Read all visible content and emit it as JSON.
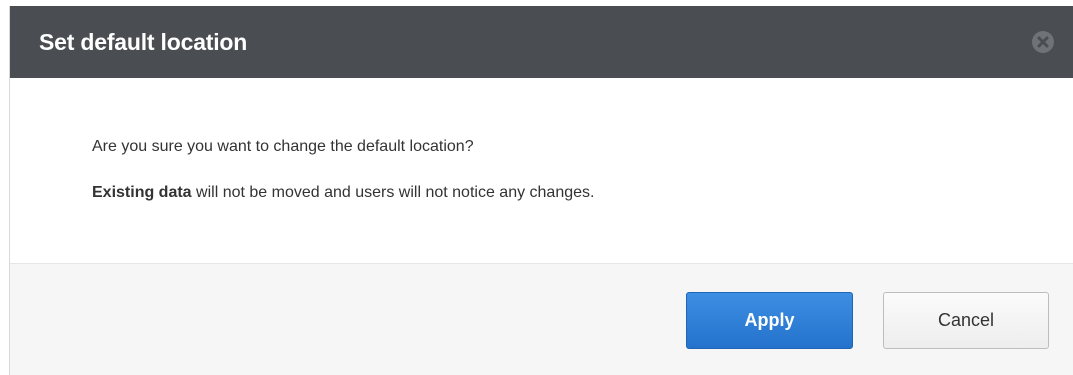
{
  "dialog": {
    "title": "Set default location",
    "close_icon": "close-icon",
    "message": {
      "line1": "Are you sure you want to change the default location?",
      "line2_bold": "Existing data",
      "line2_rest": " will not be moved and users will not notice any changes."
    },
    "buttons": {
      "apply_label": "Apply",
      "cancel_label": "Cancel"
    }
  },
  "colors": {
    "header_bg": "#4a4d52",
    "primary_button": "#2a7fd8",
    "footer_bg": "#f6f6f6"
  }
}
